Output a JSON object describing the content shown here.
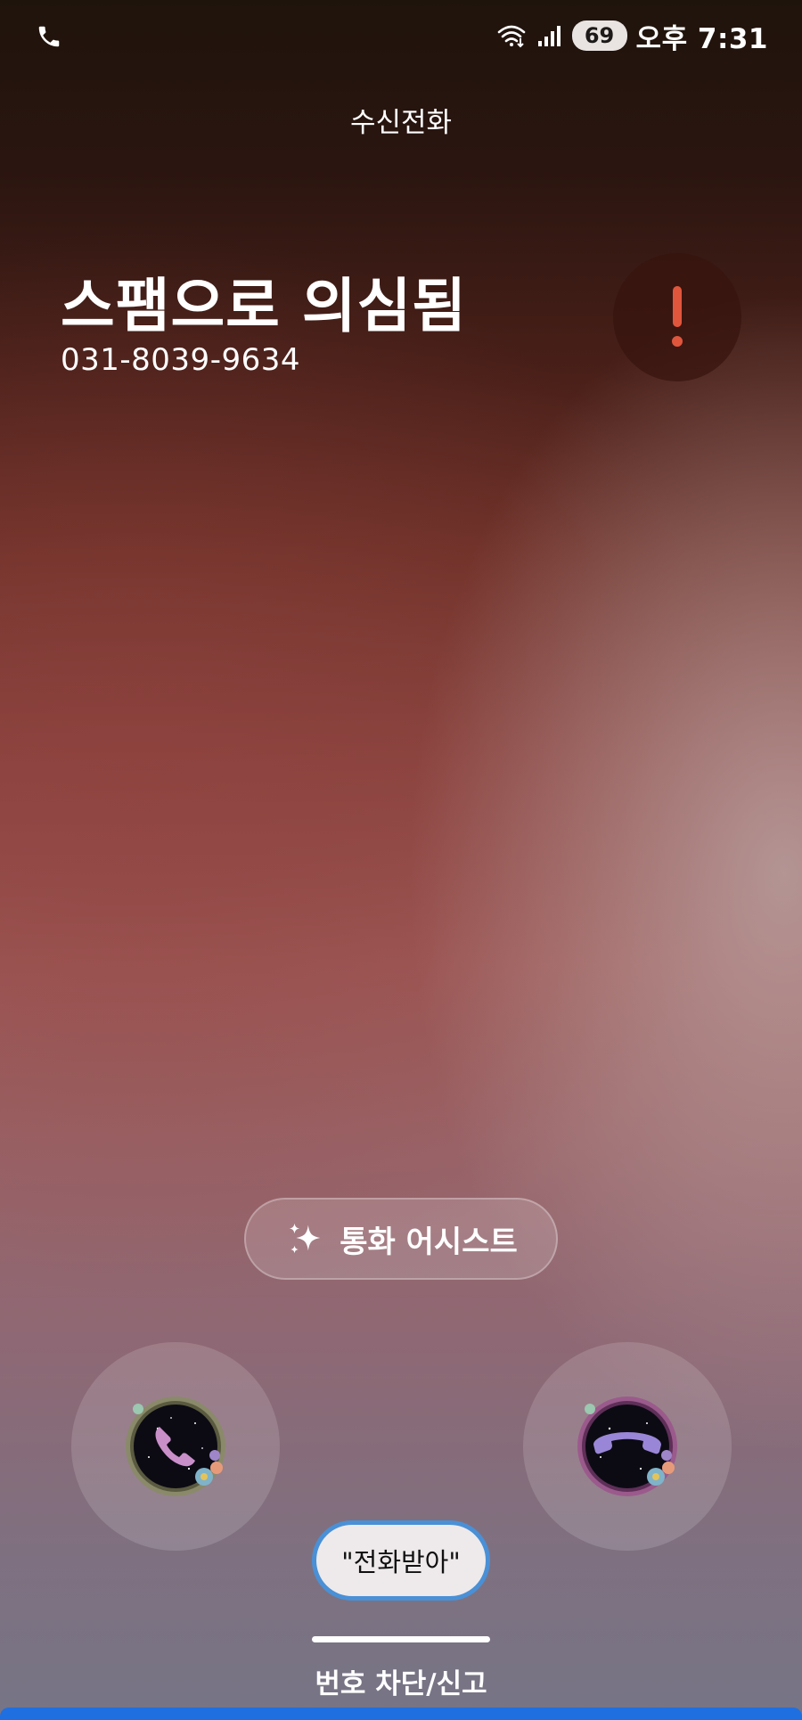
{
  "status_bar": {
    "left_icon": "phone-icon",
    "icons": [
      "wifi-icon",
      "signal-icon"
    ],
    "battery": "69",
    "time": "오후 7:31"
  },
  "call": {
    "type_label": "수신전화",
    "caller_name": "스팸으로 의심됨",
    "caller_number": "031-8039-9634",
    "alert_icon": "exclamation-icon",
    "alert_color": "#e0563d"
  },
  "assist": {
    "icon": "sparkle-icon",
    "label": "통화 어시스트"
  },
  "actions": {
    "accept_icon": "phone-accept-icon",
    "decline_icon": "phone-decline-icon",
    "accent": "#c98fc9"
  },
  "voice_command": {
    "label": "\"전화받아\"",
    "border_color": "#4a90d6"
  },
  "footer": {
    "block_report_label": "번호 차단/신고"
  }
}
